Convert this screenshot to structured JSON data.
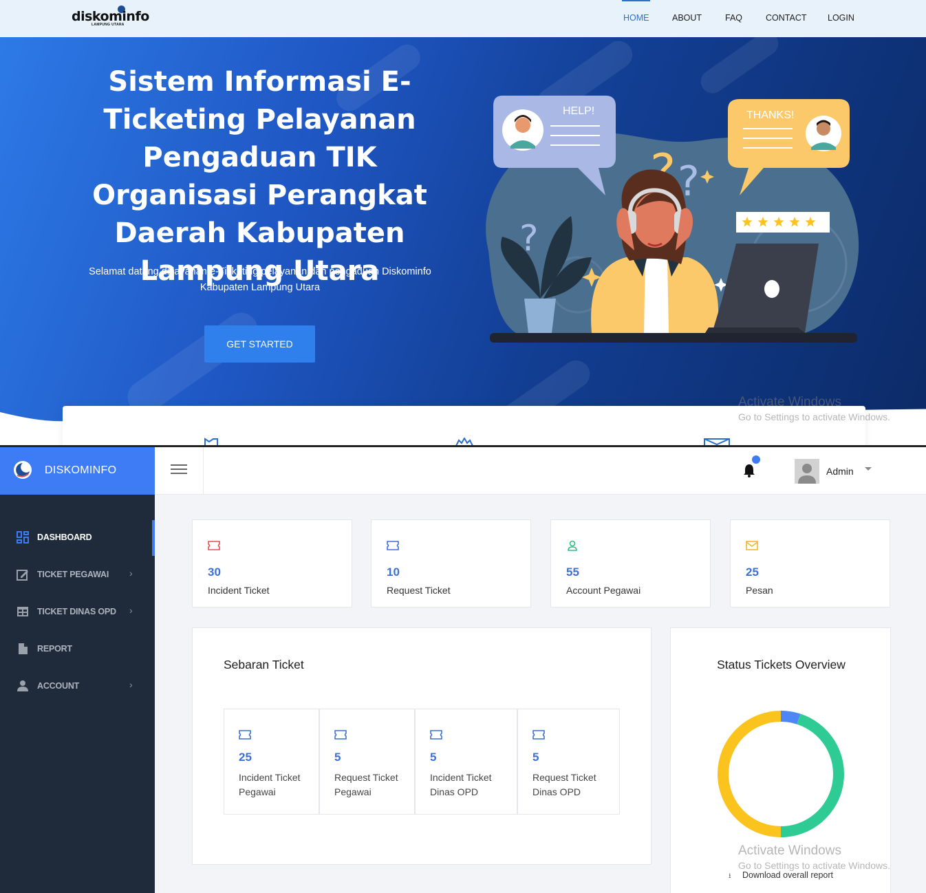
{
  "landing": {
    "logo": {
      "text": "diskominfo",
      "subtext": "LAMPUNG UTARA"
    },
    "nav": [
      {
        "label": "HOME",
        "active": true
      },
      {
        "label": "ABOUT",
        "active": false
      },
      {
        "label": "FAQ",
        "active": false
      },
      {
        "label": "CONTACT",
        "active": false
      },
      {
        "label": "LOGIN",
        "active": false
      }
    ],
    "hero": {
      "title": "Sistem Informasi E-Ticketing Pelayanan Pengaduan TIK Organisasi Perangkat Daerah Kabupaten Lampung Utara",
      "subtitle": "Selamat datang di layanan e-Ticketing pelayanan dan pengaduan Diskominfo Kabupaten Lampung Utara",
      "cta_label": "GET STARTED",
      "illustration": {
        "help_bubble": "HELP!",
        "thanks_bubble": "THANKS!",
        "rating_stars": 5
      }
    }
  },
  "watermark": {
    "title": "Activate Windows",
    "subtitle": "Go to Settings to activate Windows."
  },
  "admin": {
    "brand": "DISKOMINFO",
    "user_name": "Admin",
    "sidebar": [
      {
        "label": "DASHBOARD",
        "icon": "dashboard-icon",
        "active": true,
        "has_submenu": false
      },
      {
        "label": "TICKET PEGAWAI",
        "icon": "edit-note-icon",
        "active": false,
        "has_submenu": true
      },
      {
        "label": "TICKET DINAS OPD",
        "icon": "table-icon",
        "active": false,
        "has_submenu": true
      },
      {
        "label": "REPORT",
        "icon": "document-icon",
        "active": false,
        "has_submenu": false
      },
      {
        "label": "ACCOUNT",
        "icon": "person-icon",
        "active": false,
        "has_submenu": true
      }
    ],
    "stats": [
      {
        "value": "30",
        "label": "Incident Ticket",
        "icon": "ticket-icon",
        "color": "#e05252"
      },
      {
        "value": "10",
        "label": "Request Ticket",
        "icon": "ticket-icon",
        "color": "#3d6fd8"
      },
      {
        "value": "55",
        "label": "Account Pegawai",
        "icon": "user-icon",
        "color": "#2fbf85"
      },
      {
        "value": "25",
        "label": "Pesan",
        "icon": "mail-icon",
        "color": "#f2b632"
      }
    ],
    "sebaran": {
      "title": "Sebaran Ticket",
      "items": [
        {
          "value": "25",
          "label": "Incident Ticket Pegawai"
        },
        {
          "value": "5",
          "label": "Request Ticket Pegawai"
        },
        {
          "value": "5",
          "label": "Incident Ticket Dinas OPD"
        },
        {
          "value": "5",
          "label": "Request Ticket Dinas OPD"
        }
      ]
    },
    "status_overview": {
      "title": "Status Tickets Overview",
      "download_label": "Download overall report",
      "segments_percent": [
        {
          "color": "#4f86f7",
          "value": 5
        },
        {
          "color": "#2ecc94",
          "value": 45
        },
        {
          "color": "#fbc31d",
          "value": 50
        }
      ]
    }
  }
}
